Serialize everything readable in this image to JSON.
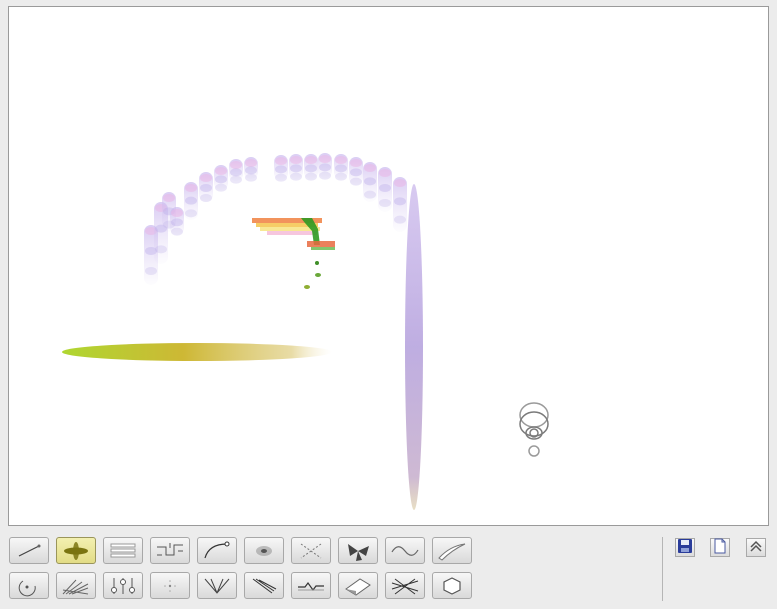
{
  "toolbar": {
    "row1": [
      {
        "icon": "line-brush-icon",
        "active": false
      },
      {
        "icon": "ellipse-brush-icon",
        "active": true
      },
      {
        "icon": "ribbon-brush-icon",
        "active": false
      },
      {
        "icon": "circuit-brush-icon",
        "active": false
      },
      {
        "icon": "curve-brush-icon",
        "active": false
      },
      {
        "icon": "blur-brush-icon",
        "active": false
      },
      {
        "icon": "dots-brush-icon",
        "active": false
      },
      {
        "icon": "fan-brush-icon",
        "active": false
      },
      {
        "icon": "wave-brush-icon",
        "active": false
      },
      {
        "icon": "swoosh-brush-icon",
        "active": false
      }
    ],
    "row2": [
      {
        "icon": "spiral-brush-icon",
        "active": false
      },
      {
        "icon": "fur-brush-icon",
        "active": false
      },
      {
        "icon": "stem-brush-icon",
        "active": false
      },
      {
        "icon": "spray-brush-icon",
        "active": false
      },
      {
        "icon": "web-brush-icon",
        "active": false
      },
      {
        "icon": "sketch-brush-icon",
        "active": false
      },
      {
        "icon": "zigzag-brush-icon",
        "active": false
      },
      {
        "icon": "eraser-brush-icon",
        "active": false
      },
      {
        "icon": "crosshatch-brush-icon",
        "active": false
      },
      {
        "icon": "hexagon-brush-icon",
        "active": false
      }
    ]
  },
  "actions": [
    {
      "icon": "save-icon"
    },
    {
      "icon": "new-page-icon"
    },
    {
      "icon": "collapse-icon"
    }
  ],
  "colors": {
    "lavender": "#b7a4e0",
    "olive": "#c9b22a",
    "lime": "#9fd21c",
    "green": "#2f9a22",
    "orange": "#f08040",
    "active_tool": "#e2dc86"
  }
}
